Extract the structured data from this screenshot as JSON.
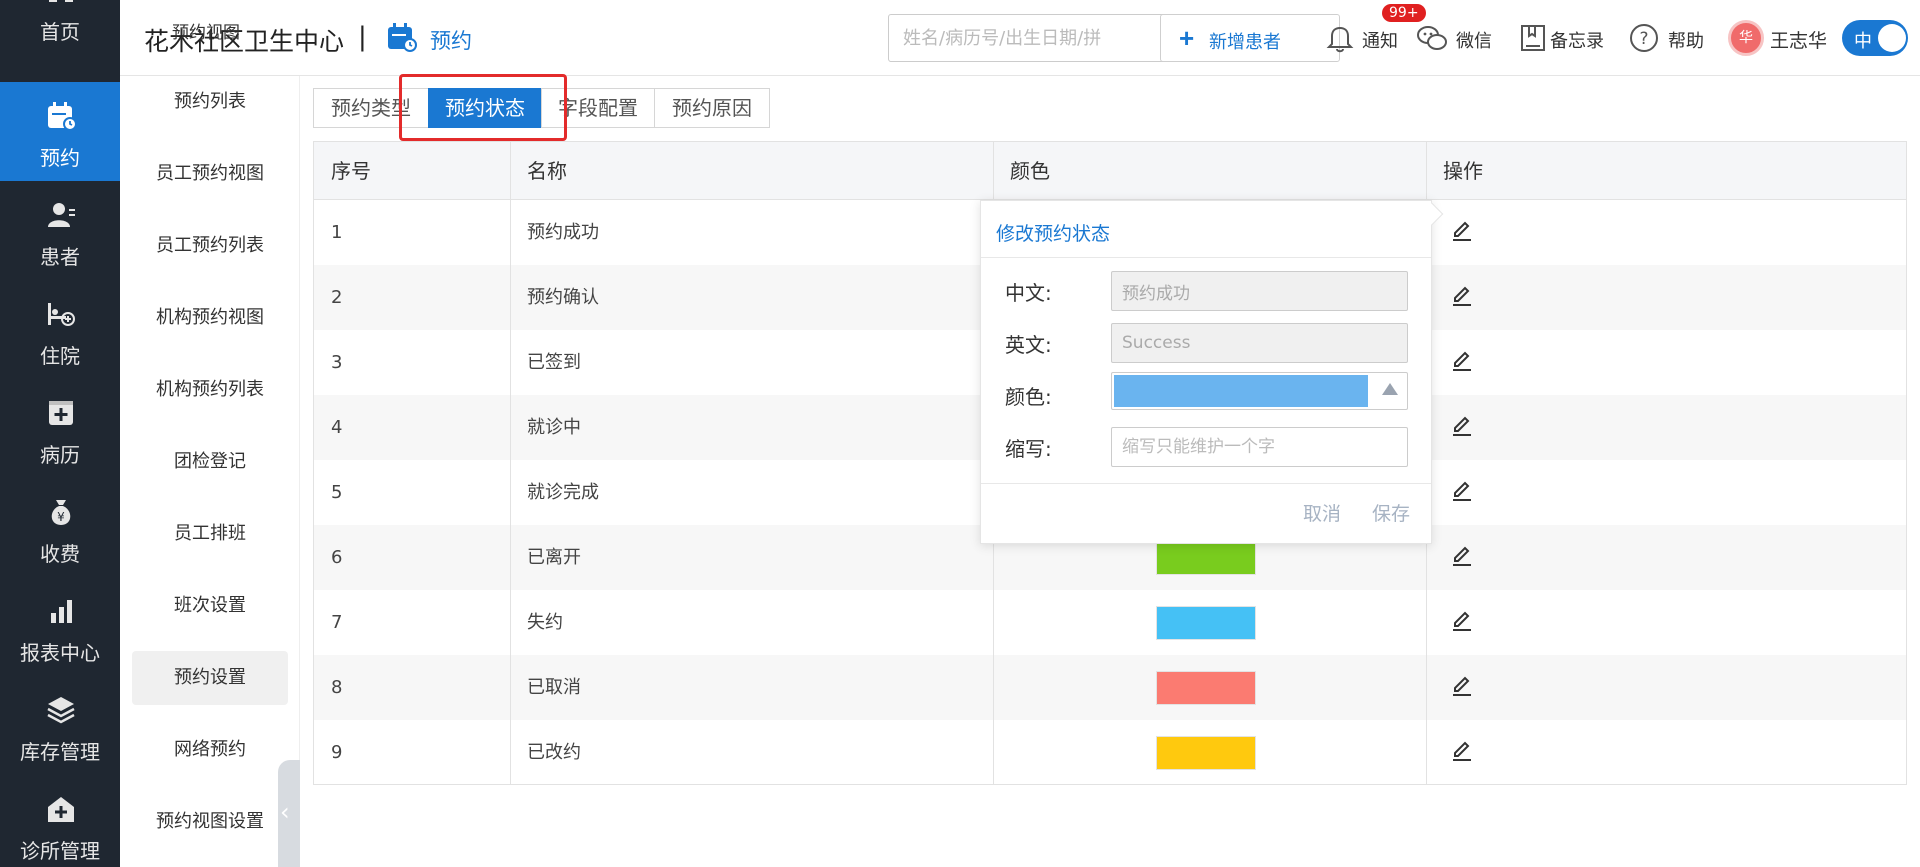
{
  "nav": {
    "items": [
      {
        "label": "首页",
        "icon": "home-icon"
      },
      {
        "label": "预约",
        "icon": "calendar-icon",
        "active": true
      },
      {
        "label": "患者",
        "icon": "patient-icon"
      },
      {
        "label": "住院",
        "icon": "bed-icon"
      },
      {
        "label": "病历",
        "icon": "medical-record-icon"
      },
      {
        "label": "收费",
        "icon": "money-bag-icon"
      },
      {
        "label": "报表中心",
        "icon": "bar-chart-icon"
      },
      {
        "label": "库存管理",
        "icon": "layers-icon"
      },
      {
        "label": "诊所管理",
        "icon": "clinic-icon"
      }
    ]
  },
  "header": {
    "clinic_name": "花木社区卫生中心",
    "separator": "|",
    "module_title": "预约",
    "search_placeholder": "姓名/病历号/出生日期/拼",
    "add_patient_label": "新增患者",
    "notify_label": "通知",
    "notify_badge": "99+",
    "wechat_label": "微信",
    "memo_label": "备忘录",
    "help_label": "帮助",
    "avatar_text": "华",
    "user_name": "王志华",
    "lang_toggle": "中"
  },
  "submenu": {
    "ghost_label": "预约视图",
    "items": [
      "预约列表",
      "员工预约视图",
      "员工预约列表",
      "机构预约视图",
      "机构预约列表",
      "团检登记",
      "员工排班",
      "班次设置",
      "预约设置",
      "网络预约",
      "预约视图设置"
    ],
    "active_index": 8
  },
  "tabs": [
    {
      "label": "预约类型"
    },
    {
      "label": "预约状态",
      "active": true
    },
    {
      "label": "字段配置"
    },
    {
      "label": "预约原因"
    }
  ],
  "table": {
    "headers": [
      "序号",
      "名称",
      "颜色",
      "操作"
    ],
    "rows": [
      {
        "no": "1",
        "name": "预约成功",
        "color": ""
      },
      {
        "no": "2",
        "name": "预约确认",
        "color": ""
      },
      {
        "no": "3",
        "name": "已签到",
        "color": ""
      },
      {
        "no": "4",
        "name": "就诊中",
        "color": ""
      },
      {
        "no": "5",
        "name": "就诊完成",
        "color": ""
      },
      {
        "no": "6",
        "name": "已离开",
        "color": "#79cc1e"
      },
      {
        "no": "7",
        "name": "失约",
        "color": "#45c1f5"
      },
      {
        "no": "8",
        "name": "已取消",
        "color": "#fb7b71"
      },
      {
        "no": "9",
        "name": "已改约",
        "color": "#ffc90e"
      }
    ]
  },
  "popover": {
    "title": "修改预约状态",
    "chinese_label": "中文:",
    "chinese_value": "预约成功",
    "english_label": "英文:",
    "english_value": "Success",
    "color_label": "颜色:",
    "color_value": "#6ab4ef",
    "abbr_label": "缩写:",
    "abbr_placeholder": "缩写只能维护一个字",
    "cancel_label": "取消",
    "save_label": "保存"
  },
  "colors": {
    "accent": "#1a78d2",
    "nav_bg": "#1f2731",
    "highlight": "#e32b2b"
  }
}
